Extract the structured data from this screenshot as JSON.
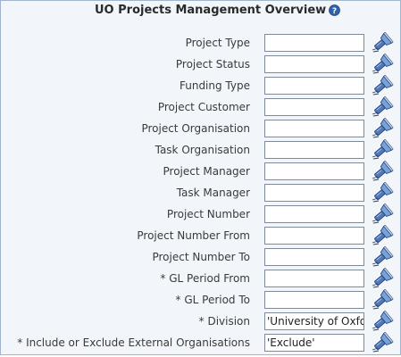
{
  "header": {
    "title": "UO Projects Management Overview",
    "help_icon": "help-icon"
  },
  "fields": [
    {
      "label": "Project Type",
      "value": ""
    },
    {
      "label": "Project Status",
      "value": ""
    },
    {
      "label": "Funding Type",
      "value": ""
    },
    {
      "label": "Project Customer",
      "value": ""
    },
    {
      "label": "Project Organisation",
      "value": ""
    },
    {
      "label": "Task Organisation",
      "value": ""
    },
    {
      "label": "Project Manager",
      "value": ""
    },
    {
      "label": "Task Manager",
      "value": ""
    },
    {
      "label": "Project Number",
      "value": ""
    },
    {
      "label": "Project Number From",
      "value": ""
    },
    {
      "label": "Project Number To",
      "value": ""
    },
    {
      "label": "* GL Period From",
      "value": ""
    },
    {
      "label": "* GL Period To",
      "value": ""
    },
    {
      "label": "* Division",
      "value": "'University of Oxford'"
    },
    {
      "label": "* Include or Exclude External Organisations",
      "value": "'Exclude'"
    }
  ],
  "icons": {
    "lov": "flashlight-search-icon"
  },
  "colors": {
    "panel_bg": "#f2f6fb",
    "panel_border": "#9fb6cd",
    "help_blue": "#2f62a8"
  }
}
